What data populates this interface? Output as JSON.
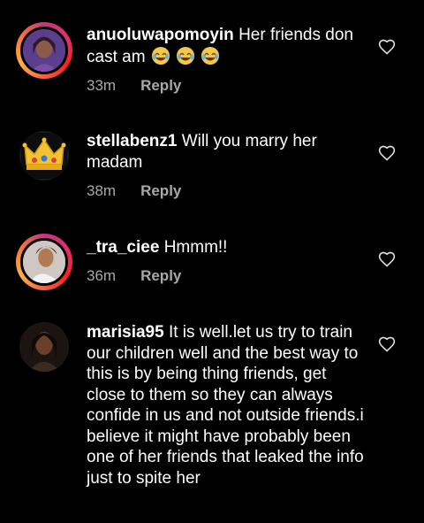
{
  "comments": [
    {
      "username": "anuoluwapomoyin",
      "text": "Her friends don cast am",
      "emojis": [
        "😂",
        "😂",
        "😂"
      ],
      "time": "33m",
      "reply_label": "Reply",
      "avatar": "avatar-woman-photo",
      "story_ring": true
    },
    {
      "username": "stellabenz1",
      "text": "Will you marry her madam",
      "time": "38m",
      "reply_label": "Reply",
      "avatar": "crown-emoji-avatar",
      "story_ring": false
    },
    {
      "username": "_tra_ciee",
      "text": "Hmmm!!",
      "time": "36m",
      "reply_label": "Reply",
      "avatar": "avatar-woman-photo",
      "story_ring": true
    },
    {
      "username": "marisia95",
      "text": "It is well.let us try to train our children well and the best way to this is by being thing friends, get close to them so they can always confide in us and not outside friends.i believe it might have probably been one of her friends that leaked the info just to spite her",
      "avatar": "avatar-woman-photo",
      "story_ring": false
    }
  ],
  "colors": {
    "background": "#000000",
    "meta": "#a8a8a8",
    "text": "#ffffff"
  },
  "icons": {
    "like": "heart-outline-icon"
  }
}
